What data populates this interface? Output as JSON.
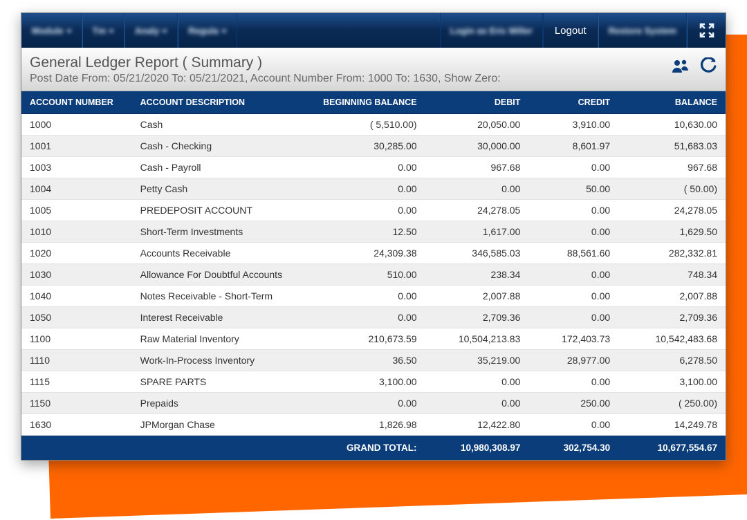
{
  "topbar": {
    "logout_label": "Logout"
  },
  "title": {
    "main": "General Ledger Report ( Summary )",
    "sub": "Post Date From: 05/21/2020 To: 05/21/2021, Account Number From: 1000 To: 1630, Show Zero:"
  },
  "columns": {
    "account_number": "ACCOUNT NUMBER",
    "account_description": "ACCOUNT DESCRIPTION",
    "beginning_balance": "BEGINNING BALANCE",
    "debit": "DEBIT",
    "credit": "CREDIT",
    "balance": "BALANCE"
  },
  "rows": [
    {
      "acct": "1000",
      "desc": "Cash",
      "beg": "( 5,510.00)",
      "debit": "20,050.00",
      "credit": "3,910.00",
      "bal": "10,630.00"
    },
    {
      "acct": "1001",
      "desc": "Cash - Checking",
      "beg": "30,285.00",
      "debit": "30,000.00",
      "credit": "8,601.97",
      "bal": "51,683.03"
    },
    {
      "acct": "1003",
      "desc": "Cash - Payroll",
      "beg": "0.00",
      "debit": "967.68",
      "credit": "0.00",
      "bal": "967.68"
    },
    {
      "acct": "1004",
      "desc": "Petty Cash",
      "beg": "0.00",
      "debit": "0.00",
      "credit": "50.00",
      "bal": "( 50.00)"
    },
    {
      "acct": "1005",
      "desc": "PREDEPOSIT ACCOUNT",
      "beg": "0.00",
      "debit": "24,278.05",
      "credit": "0.00",
      "bal": "24,278.05"
    },
    {
      "acct": "1010",
      "desc": "Short-Term Investments",
      "beg": "12.50",
      "debit": "1,617.00",
      "credit": "0.00",
      "bal": "1,629.50"
    },
    {
      "acct": "1020",
      "desc": "Accounts Receivable",
      "beg": "24,309.38",
      "debit": "346,585.03",
      "credit": "88,561.60",
      "bal": "282,332.81"
    },
    {
      "acct": "1030",
      "desc": "Allowance For Doubtful Accounts",
      "beg": "510.00",
      "debit": "238.34",
      "credit": "0.00",
      "bal": "748.34"
    },
    {
      "acct": "1040",
      "desc": "Notes Receivable - Short-Term",
      "beg": "0.00",
      "debit": "2,007.88",
      "credit": "0.00",
      "bal": "2,007.88"
    },
    {
      "acct": "1050",
      "desc": "Interest Receivable",
      "beg": "0.00",
      "debit": "2,709.36",
      "credit": "0.00",
      "bal": "2,709.36"
    },
    {
      "acct": "1100",
      "desc": "Raw Material Inventory",
      "beg": "210,673.59",
      "debit": "10,504,213.83",
      "credit": "172,403.73",
      "bal": "10,542,483.68"
    },
    {
      "acct": "1110",
      "desc": "Work-In-Process Inventory",
      "beg": "36.50",
      "debit": "35,219.00",
      "credit": "28,977.00",
      "bal": "6,278.50"
    },
    {
      "acct": "1115",
      "desc": "SPARE PARTS",
      "beg": "3,100.00",
      "debit": "0.00",
      "credit": "0.00",
      "bal": "3,100.00"
    },
    {
      "acct": "1150",
      "desc": "Prepaids",
      "beg": "0.00",
      "debit": "0.00",
      "credit": "250.00",
      "bal": "( 250.00)"
    },
    {
      "acct": "1630",
      "desc": "JPMorgan Chase",
      "beg": "1,826.98",
      "debit": "12,422.80",
      "credit": "0.00",
      "bal": "14,249.78"
    }
  ],
  "footer": {
    "label": "GRAND TOTAL:",
    "debit": "10,980,308.97",
    "credit": "302,754.30",
    "balance": "10,677,554.67"
  }
}
